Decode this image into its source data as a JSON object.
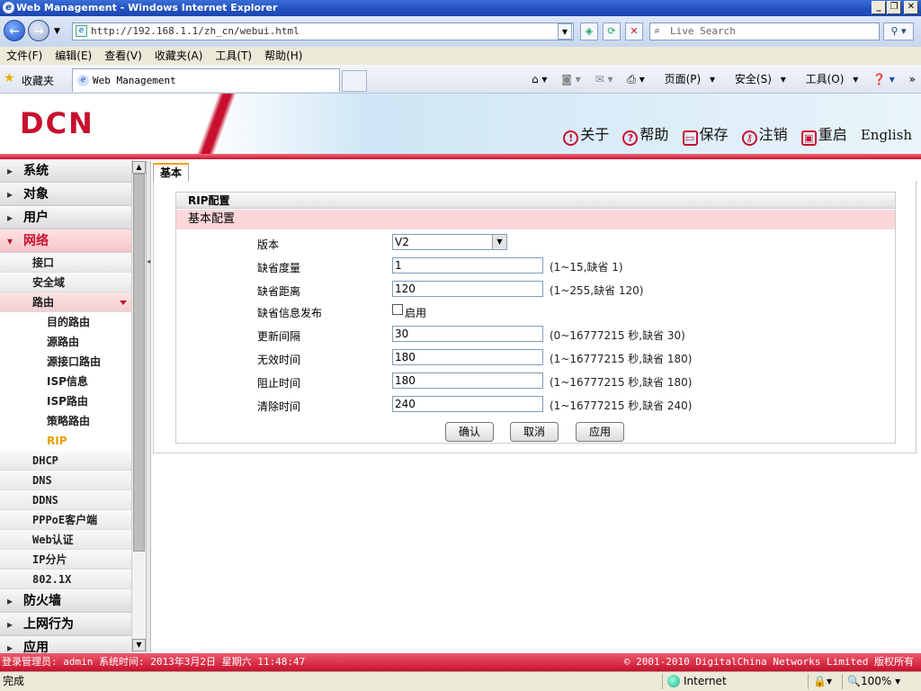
{
  "window": {
    "title": "Web Management - Windows Internet Explorer"
  },
  "browser": {
    "url": "http://192.168.1.1/zh_cn/webui.html",
    "search_placeholder": "Live Search",
    "menu": [
      "文件(F)",
      "编辑(E)",
      "查看(V)",
      "收藏夹(A)",
      "工具(T)",
      "帮助(H)"
    ],
    "favorites_label": "收藏夹",
    "tab_title": "Web Management",
    "cmd": {
      "page": "页面(P)",
      "safety": "安全(S)",
      "tools": "工具(O)"
    },
    "status": {
      "done": "完成",
      "zone": "Internet",
      "zoom": "100%"
    }
  },
  "header": {
    "logo": "DCN",
    "links": {
      "about": "关于",
      "help": "帮助",
      "save": "保存",
      "logout": "注销",
      "reboot": "重启",
      "english": "English"
    }
  },
  "sidebar": {
    "groups_top": [
      "系统",
      "对象",
      "用户"
    ],
    "network": "网络",
    "network_items": {
      "interface": "接口",
      "zone": "安全域",
      "route": "路由"
    },
    "route_items": [
      "目的路由",
      "源路由",
      "源接口路由",
      "ISP信息",
      "ISP路由",
      "策略路由",
      "RIP"
    ],
    "network_more": [
      "DHCP",
      "DNS",
      "DDNS",
      "PPPoE客户端",
      "Web认证",
      "IP分片",
      "802.1X"
    ],
    "groups_bottom": [
      "防火墙",
      "上网行为",
      "应用"
    ]
  },
  "content": {
    "tab": "基本",
    "panel_title": "RIP配置",
    "section": "基本配置",
    "version": {
      "label": "版本",
      "value": "V2"
    },
    "metric": {
      "label": "缺省度量",
      "value": "1",
      "hint": "(1~15,缺省 1)"
    },
    "distance": {
      "label": "缺省距离",
      "value": "120",
      "hint": "(1~255,缺省 120)"
    },
    "default_info": {
      "label": "缺省信息发布",
      "checkbox": "启用"
    },
    "update": {
      "label": "更新间隔",
      "value": "30",
      "hint": "(0~16777215 秒,缺省 30)"
    },
    "invalid": {
      "label": "无效时间",
      "value": "180",
      "hint": "(1~16777215 秒,缺省 180)"
    },
    "holddown": {
      "label": "阻止时间",
      "value": "180",
      "hint": "(1~16777215 秒,缺省 180)"
    },
    "flush": {
      "label": "清除时间",
      "value": "240",
      "hint": "(1~16777215 秒,缺省 240)"
    },
    "buttons": {
      "ok": "确认",
      "cancel": "取消",
      "apply": "应用"
    }
  },
  "footer": {
    "left": "登录管理员: admin 系统时间: 2013年3月2日 星期六 11:48:47",
    "right": "© 2001-2010 DigitalChina Networks Limited 版权所有"
  }
}
